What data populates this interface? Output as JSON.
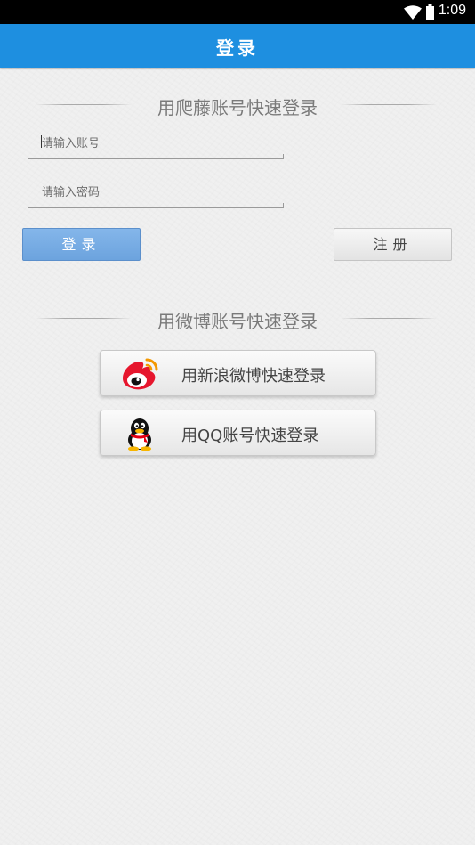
{
  "status_bar": {
    "time": "1:09",
    "icons": [
      "wifi-icon",
      "battery-icon"
    ]
  },
  "app_bar": {
    "title": "登录"
  },
  "account_section": {
    "header": "用爬藤账号快速登录",
    "username_placeholder": "请输入账号",
    "password_placeholder": "请输入密码",
    "login_label": "登录",
    "register_label": "注册"
  },
  "social_section": {
    "header": "用微博账号快速登录",
    "weibo": {
      "label": "用新浪微博快速登录",
      "icon": "weibo-icon"
    },
    "qq": {
      "label": "用QQ账号快速登录",
      "icon": "qq-penguin-icon"
    }
  },
  "colors": {
    "accent": "#1e8fe0",
    "login_button": "#78aee4",
    "background": "#f0f0f0"
  }
}
